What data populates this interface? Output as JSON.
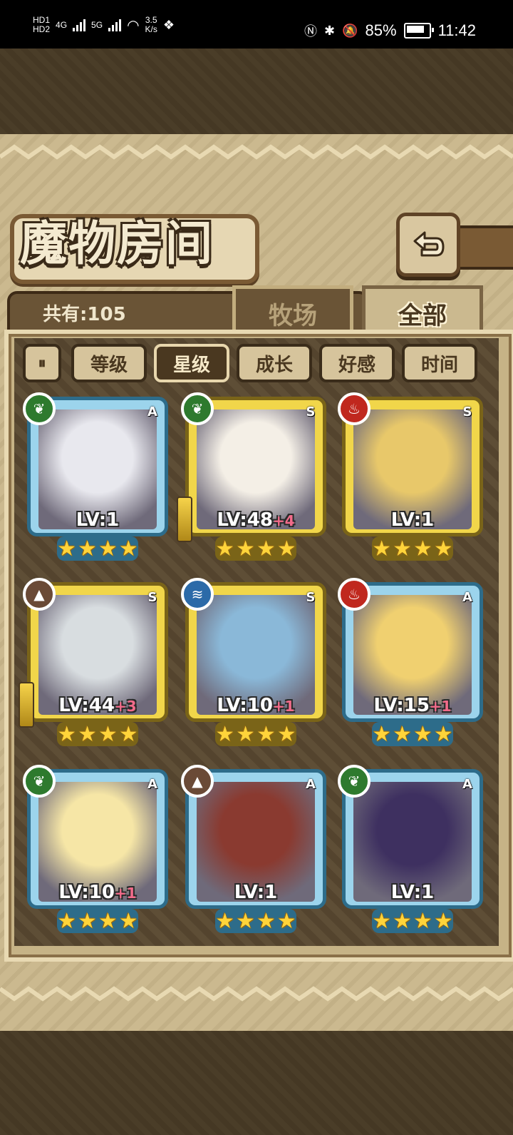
{
  "status_bar": {
    "network_type": "4G",
    "network_type2": "5G",
    "hd1": "HD",
    "hd2": "HD",
    "speed_value": "3.5",
    "speed_unit": "K/s",
    "battery_percent": "85%",
    "time": "11:42"
  },
  "header": {
    "title": "魔物房间",
    "count_label": "共有:105"
  },
  "tabs": [
    {
      "label": "牧场",
      "active": false
    },
    {
      "label": "全部",
      "active": true
    }
  ],
  "sort": {
    "toggle_icon": "pause-play-icon",
    "buttons": [
      {
        "label": "等级",
        "active": false
      },
      {
        "label": "星级",
        "active": true
      },
      {
        "label": "成长",
        "active": false
      },
      {
        "label": "好感",
        "active": false
      },
      {
        "label": "时间",
        "active": false
      }
    ]
  },
  "monsters": [
    {
      "rarity": "A",
      "element": "grass",
      "level": "LV:1",
      "plus": "",
      "stars": 4,
      "weapon": false,
      "portrait_color": "#e8e8ee"
    },
    {
      "rarity": "S",
      "element": "grass",
      "level": "LV:48",
      "plus": "+4",
      "stars": 4,
      "weapon": true,
      "portrait_color": "#f4efe6"
    },
    {
      "rarity": "S",
      "element": "fire",
      "level": "LV:1",
      "plus": "",
      "stars": 4,
      "weapon": false,
      "portrait_color": "#e8c86a"
    },
    {
      "rarity": "S",
      "element": "earth",
      "level": "LV:44",
      "plus": "+3",
      "stars": 4,
      "weapon": true,
      "portrait_color": "#d8dde0"
    },
    {
      "rarity": "S",
      "element": "water",
      "level": "LV:10",
      "plus": "+1",
      "stars": 4,
      "weapon": false,
      "portrait_color": "#8ab8d8"
    },
    {
      "rarity": "A",
      "element": "fire",
      "level": "LV:15",
      "plus": "+1",
      "stars": 4,
      "weapon": false,
      "portrait_color": "#f0d070"
    },
    {
      "rarity": "A",
      "element": "grass",
      "level": "LV:10",
      "plus": "+1",
      "stars": 4,
      "weapon": false,
      "portrait_color": "#f6e6a6"
    },
    {
      "rarity": "A",
      "element": "earth",
      "level": "LV:1",
      "plus": "",
      "stars": 4,
      "weapon": false,
      "portrait_color": "#8a3a30"
    },
    {
      "rarity": "A",
      "element": "grass",
      "level": "LV:1",
      "plus": "",
      "stars": 4,
      "weapon": false,
      "portrait_color": "#3e3060"
    }
  ],
  "colors": {
    "parchment": "#cbb98f",
    "frame_A": "#9cd4ec",
    "frame_S": "#f1d64a",
    "star": "#ffd43a",
    "plus_text": "#f26b8a"
  }
}
